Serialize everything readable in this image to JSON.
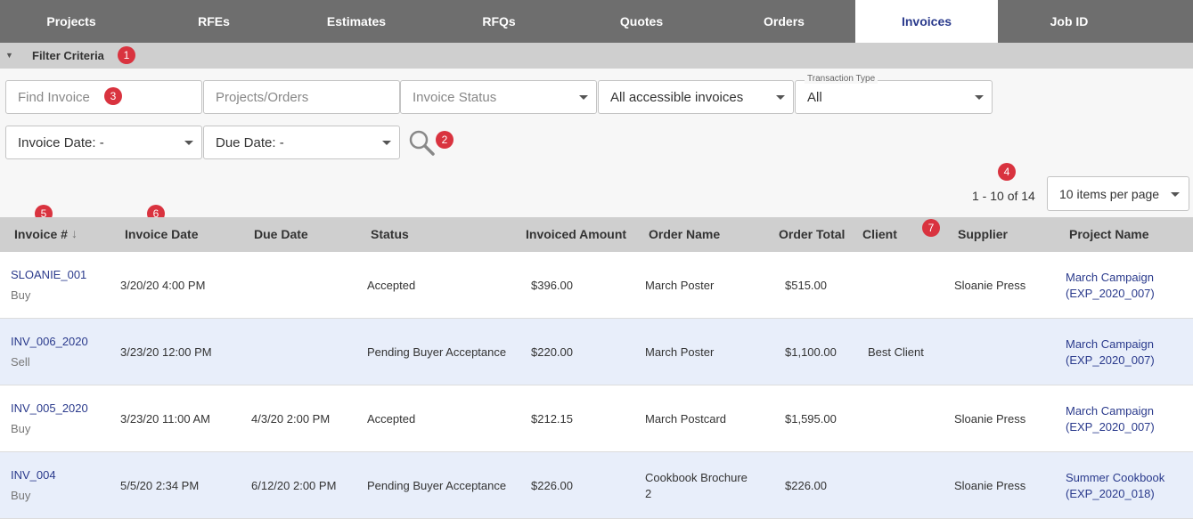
{
  "tabs": [
    {
      "label": "Projects"
    },
    {
      "label": "RFEs"
    },
    {
      "label": "Estimates"
    },
    {
      "label": "RFQs"
    },
    {
      "label": "Quotes"
    },
    {
      "label": "Orders"
    },
    {
      "label": "Invoices"
    },
    {
      "label": "Job ID"
    }
  ],
  "filter": {
    "title": "Filter Criteria",
    "toggle_glyph": "▼",
    "find_invoice_placeholder": "Find Invoice",
    "projects_orders_placeholder": "Projects/Orders",
    "invoice_status_placeholder": "Invoice Status",
    "scope_value": "All accessible invoices",
    "transaction_type_label": "Transaction Type",
    "transaction_type_value": "All",
    "invoice_date_value": "Invoice Date: -",
    "due_date_value": "Due Date: -"
  },
  "badges": [
    "1",
    "2",
    "3",
    "4",
    "5",
    "6",
    "7"
  ],
  "pagination": {
    "range": "1 - 10 of 14",
    "per_page": "10 items per page"
  },
  "table": {
    "sort_glyph": "↓",
    "headers": [
      "Invoice #",
      "Invoice Date",
      "Due Date",
      "Status",
      "Invoiced Amount",
      "Order Name",
      "Order Total",
      "Client",
      "Supplier",
      "Project Name"
    ],
    "rows": [
      {
        "invoice": "SLOANIE_001",
        "type": "Buy",
        "invoice_date": "3/20/20 4:00 PM",
        "due_date": "",
        "status": "Accepted",
        "amount": "$396.00",
        "order_name": "March Poster",
        "order_name_2": "",
        "order_total": "$515.00",
        "client": "",
        "supplier": "Sloanie Press",
        "project": "March Campaign",
        "project_code": "(EXP_2020_007)"
      },
      {
        "invoice": "INV_006_2020",
        "type": "Sell",
        "invoice_date": "3/23/20 12:00 PM",
        "due_date": "",
        "status": "Pending Buyer Acceptance",
        "amount": "$220.00",
        "order_name": "March Poster",
        "order_name_2": "",
        "order_total": "$1,100.00",
        "client": "Best Client",
        "supplier": "",
        "project": "March Campaign",
        "project_code": "(EXP_2020_007)"
      },
      {
        "invoice": "INV_005_2020",
        "type": "Buy",
        "invoice_date": "3/23/20 11:00 AM",
        "due_date": "4/3/20 2:00 PM",
        "status": "Accepted",
        "amount": "$212.15",
        "order_name": "March Postcard",
        "order_name_2": "",
        "order_total": "$1,595.00",
        "client": "",
        "supplier": "Sloanie Press",
        "project": "March Campaign",
        "project_code": "(EXP_2020_007)"
      },
      {
        "invoice": "INV_004",
        "type": "Buy",
        "invoice_date": "5/5/20 2:34 PM",
        "due_date": "6/12/20 2:00 PM",
        "status": "Pending Buyer Acceptance",
        "amount": "$226.00",
        "order_name": "Cookbook Brochure",
        "order_name_2": "2",
        "order_total": "$226.00",
        "client": "",
        "supplier": "Sloanie Press",
        "project": "Summer Cookbook",
        "project_code": "(EXP_2020_018)"
      }
    ]
  }
}
